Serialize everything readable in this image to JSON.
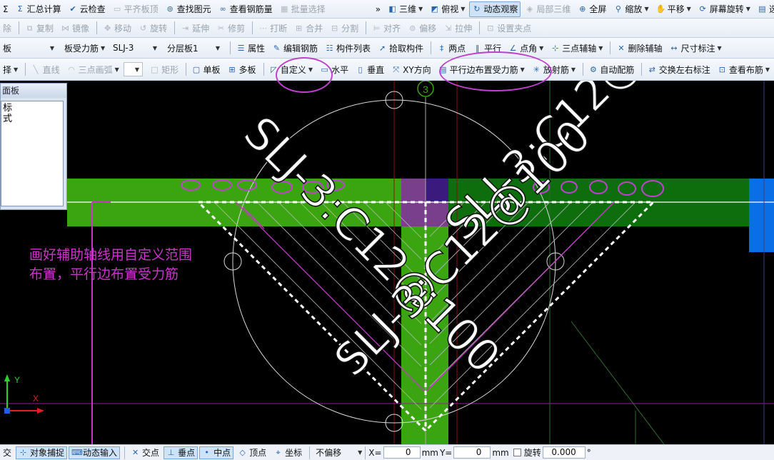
{
  "toolbar1": {
    "items": [
      {
        "label": "汇总计算",
        "icon": "sum-icon",
        "disabled": false
      },
      {
        "label": "云检查",
        "icon": "cloud-check-icon",
        "disabled": false
      },
      {
        "label": "平齐板顶",
        "icon": "align-slab-icon",
        "disabled": true
      },
      {
        "label": "查找图元",
        "icon": "binoculars-icon",
        "disabled": false
      },
      {
        "label": "查看钢筋量",
        "icon": "rebar-quantity-icon",
        "disabled": false
      },
      {
        "label": "批量选择",
        "icon": "batch-select-icon",
        "disabled": true
      }
    ],
    "left_stub": "Σ",
    "overflow": "»",
    "view_items": [
      {
        "label": "三维",
        "icon": "cube-icon",
        "active": false,
        "caret": true
      },
      {
        "label": "俯视",
        "icon": "top-view-icon",
        "active": false,
        "caret": true
      },
      {
        "label": "动态观察",
        "icon": "orbit-icon",
        "active": true,
        "caret": false
      },
      {
        "label": "局部三维",
        "icon": "local-3d-icon",
        "active": false,
        "caret": false,
        "disabled": true
      },
      {
        "label": "全屏",
        "icon": "fullscreen-icon",
        "active": false,
        "caret": false
      },
      {
        "label": "缩放",
        "icon": "zoom-icon",
        "active": false,
        "caret": true
      },
      {
        "label": "平移",
        "icon": "pan-icon",
        "active": false,
        "caret": true
      },
      {
        "label": "屏幕旋转",
        "icon": "screen-rotate-icon",
        "active": false,
        "caret": true
      },
      {
        "label": "选择",
        "icon": "select-icon",
        "active": false,
        "caret": false
      }
    ]
  },
  "toolbar2": {
    "items": [
      {
        "label": "除",
        "icon": "",
        "disabled": true
      },
      {
        "label": "复制",
        "icon": "copy-icon",
        "disabled": true
      },
      {
        "label": "镜像",
        "icon": "mirror-icon",
        "disabled": true
      },
      {
        "label": "移动",
        "icon": "move-icon",
        "disabled": true
      },
      {
        "label": "旋转",
        "icon": "rotate-icon",
        "disabled": true
      },
      {
        "label": "延伸",
        "icon": "extend-icon",
        "disabled": true
      },
      {
        "label": "修剪",
        "icon": "trim-icon",
        "disabled": true
      },
      {
        "label": "打断",
        "icon": "break-icon",
        "disabled": true
      },
      {
        "label": "合并",
        "icon": "merge-icon",
        "disabled": true
      },
      {
        "label": "分割",
        "icon": "split-icon",
        "disabled": true
      },
      {
        "label": "对齐",
        "icon": "align-icon",
        "disabled": true
      },
      {
        "label": "偏移",
        "icon": "offset-icon",
        "disabled": true
      },
      {
        "label": "拉伸",
        "icon": "stretch-icon",
        "disabled": true
      },
      {
        "label": "设置夹点",
        "icon": "grip-icon",
        "disabled": true
      }
    ]
  },
  "toolbar3": {
    "dropdowns": [
      {
        "value": "板"
      },
      {
        "value": "板受力筋"
      },
      {
        "value": "SLJ-3"
      },
      {
        "value": "分层板1"
      }
    ],
    "items": [
      {
        "label": "属性",
        "icon": "properties-icon",
        "caret": false
      },
      {
        "label": "编辑钢筋",
        "icon": "edit-rebar-icon",
        "caret": false
      },
      {
        "label": "构件列表",
        "icon": "component-list-icon",
        "caret": false
      },
      {
        "label": "拾取构件",
        "icon": "pick-component-icon",
        "caret": false
      },
      {
        "label": "两点",
        "icon": "two-point-icon",
        "caret": false
      },
      {
        "label": "平行",
        "icon": "parallel-icon",
        "caret": false
      },
      {
        "label": "点角",
        "icon": "point-angle-icon",
        "caret": true
      },
      {
        "label": "三点辅轴",
        "icon": "three-point-axis-icon",
        "caret": true
      },
      {
        "label": "删除辅轴",
        "icon": "delete-axis-icon",
        "caret": false
      },
      {
        "label": "尺寸标注",
        "icon": "dimension-icon",
        "caret": true
      }
    ]
  },
  "toolbar4": {
    "items": [
      {
        "label": "择",
        "icon": "",
        "caret": true,
        "disabled": false
      },
      {
        "label": "直线",
        "icon": "line-icon",
        "caret": false,
        "disabled": true
      },
      {
        "label": "三点画弧",
        "icon": "arc-icon",
        "caret": true,
        "disabled": true
      },
      {
        "label": "矩形",
        "icon": "rectangle-icon",
        "caret": false,
        "disabled": true
      },
      {
        "label": "单板",
        "icon": "single-slab-icon",
        "caret": false,
        "disabled": false
      },
      {
        "label": "多板",
        "icon": "multi-slab-icon",
        "caret": false,
        "disabled": false
      },
      {
        "label": "自定义",
        "icon": "custom-icon",
        "caret": true,
        "disabled": false
      },
      {
        "label": "水平",
        "icon": "horizontal-icon",
        "caret": false,
        "disabled": false
      },
      {
        "label": "垂直",
        "icon": "vertical-icon",
        "caret": false,
        "disabled": false
      },
      {
        "label": "XY方向",
        "icon": "xy-direction-icon",
        "caret": false,
        "disabled": false
      },
      {
        "label": "平行边布置受力筋",
        "icon": "parallel-edge-rebar-icon",
        "caret": true,
        "disabled": false
      },
      {
        "label": "放射筋",
        "icon": "radial-rebar-icon",
        "caret": true,
        "disabled": false
      },
      {
        "label": "自动配筋",
        "icon": "auto-rebar-icon",
        "caret": false,
        "disabled": false
      },
      {
        "label": "交换左右标注",
        "icon": "swap-label-icon",
        "caret": false,
        "disabled": false
      },
      {
        "label": "查看布筋",
        "icon": "view-rebar-icon",
        "caret": true,
        "disabled": false
      }
    ]
  },
  "panel": {
    "title": "面板",
    "line1": "标",
    "line2": "式"
  },
  "canvas": {
    "axis_number": "3",
    "rebar_label_1": "SLJ-3:C12@100",
    "rebar_label_2": "SLJ-3:C12@100",
    "rebar_label_3": "SLJ-3:C12@100",
    "annotation_line1": "画好辅助轴线用自定义范围",
    "annotation_line2": "布置，平行边布置受力筋",
    "ucs_x": "X",
    "ucs_y": "Y"
  },
  "colors": {
    "slab_green": "#3aa510",
    "slab_dark_green": "#0e6e0e",
    "annotation_magenta": "#c935c9",
    "rebar_white": "#ffffff",
    "highlight_ring": "#c040d0",
    "blue_column": "#0a6ee6",
    "purple_block": "#7a3f8c",
    "dark_purple_block": "#3a1a7c"
  },
  "statusbar": {
    "left_stub": "交",
    "snap": [
      {
        "label": "对象捕捉",
        "icon": "snap-icon",
        "on": true
      },
      {
        "label": "动态输入",
        "icon": "dynamic-input-icon",
        "on": true
      },
      {
        "label": "交点",
        "icon": "intersection-icon",
        "on": false
      },
      {
        "label": "垂点",
        "icon": "perpendicular-icon",
        "on": true
      },
      {
        "label": "中点",
        "icon": "midpoint-icon",
        "on": true
      },
      {
        "label": "顶点",
        "icon": "vertex-icon",
        "on": false
      },
      {
        "label": "坐标",
        "icon": "coordinate-icon",
        "on": false
      }
    ],
    "offset_select": "不偏移",
    "x_label": "X=",
    "x_value": "0",
    "y_label": "Y=",
    "y_value": "0",
    "unit": "mm",
    "rotate_label": "旋转",
    "rotate_value": "0.000",
    "rotate_unit": "°"
  }
}
